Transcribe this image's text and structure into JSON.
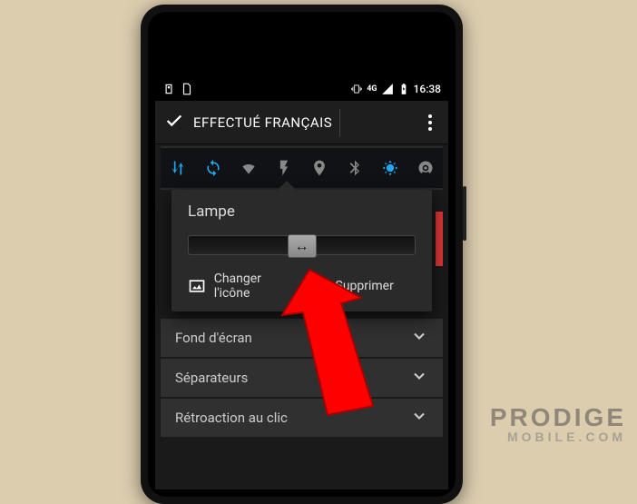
{
  "statusbar": {
    "time": "16:38",
    "network_label": "4G"
  },
  "titlebar": {
    "title": "EFFECTUÉ FRANÇAIS"
  },
  "toggles": [
    {
      "name": "data-arrows",
      "active": true
    },
    {
      "name": "sync",
      "active": true
    },
    {
      "name": "wifi",
      "active": false
    },
    {
      "name": "flash",
      "active": false
    },
    {
      "name": "location",
      "active": false
    },
    {
      "name": "bluetooth",
      "active": false
    },
    {
      "name": "brightness",
      "active": true
    },
    {
      "name": "hotspot",
      "active": false
    }
  ],
  "popup": {
    "title": "Lampe",
    "change_icon_label": "Changer l'icône",
    "delete_label": "Supprimer"
  },
  "list": [
    {
      "label": "Fond d'écran"
    },
    {
      "label": "Séparateurs"
    },
    {
      "label": "Rétroaction au clic"
    }
  ],
  "watermark": {
    "line1": "PRODIGE",
    "line2": "MOBILE.COM"
  }
}
